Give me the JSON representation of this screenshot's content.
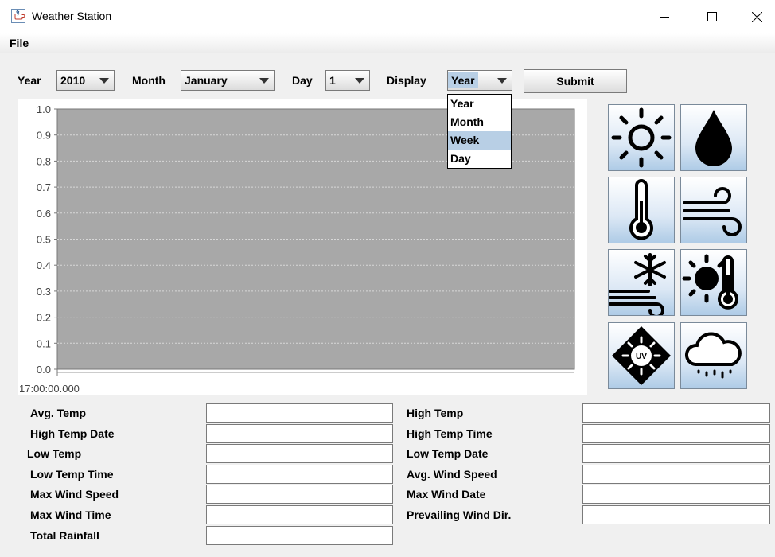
{
  "window": {
    "title": "Weather Station",
    "controls": {
      "minimize": "—",
      "maximize": "☐",
      "close": "✕"
    }
  },
  "menu": {
    "file": "File"
  },
  "controls": {
    "year_label": "Year",
    "year_value": "2010",
    "month_label": "Month",
    "month_value": "January",
    "day_label": "Day",
    "day_value": "1",
    "display_label": "Display",
    "display_value": "Year",
    "submit_label": "Submit",
    "display_options": [
      "Year",
      "Month",
      "Week",
      "Day"
    ],
    "display_highlighted": "Week"
  },
  "chart_data": {
    "type": "line",
    "title": "",
    "xlabel": "",
    "ylabel": "",
    "ylim": [
      0.0,
      1.0
    ],
    "y_ticks": [
      "0.0",
      "0.1",
      "0.2",
      "0.3",
      "0.4",
      "0.5",
      "0.6",
      "0.7",
      "0.8",
      "0.9",
      "1.0"
    ],
    "x_ticks": [
      "17:00:00.000"
    ],
    "series": [],
    "plot_background": "#a8a8a8",
    "grid": true
  },
  "icon_buttons": [
    "sun-icon",
    "raindrop-icon",
    "thermometer-icon",
    "wind-icon",
    "snow-wind-icon",
    "sun-thermometer-icon",
    "uv-index-icon",
    "rain-cloud-icon"
  ],
  "stats": {
    "left": [
      "Avg. Temp",
      "High Temp Date",
      "Low Temp",
      "Low Temp Time",
      "Max Wind Speed",
      "Max Wind Time",
      "Total Rainfall"
    ],
    "right": [
      "High Temp",
      "High Temp Time",
      "Low Temp Date",
      "Avg. Wind Speed",
      "Max Wind Date",
      "Prevailing Wind Dir."
    ]
  }
}
